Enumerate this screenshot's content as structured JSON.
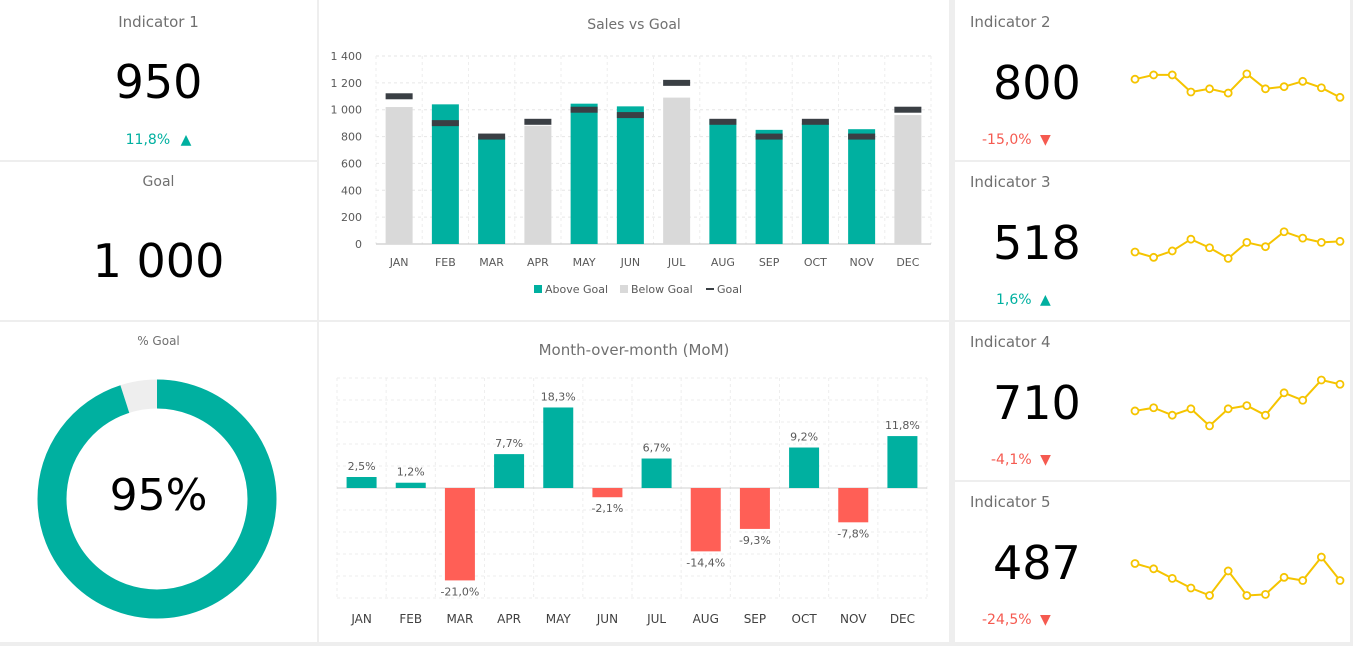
{
  "colors": {
    "teal": "#00b0a0",
    "gray": "#d9d9d9",
    "dark": "#3a3f44",
    "red": "#ff5f56",
    "yellow": "#f5c400"
  },
  "left": {
    "indicator1": {
      "title": "Indicator 1",
      "value": "950",
      "change": "11,8%",
      "direction": "up"
    },
    "goal": {
      "title": "Goal",
      "value": "1 000"
    },
    "pct_goal": {
      "title": "% Goal",
      "value": "95%",
      "fraction": 0.95
    }
  },
  "right": [
    {
      "title": "Indicator 2",
      "value": "800",
      "change": "-15,0%",
      "direction": "down",
      "trend": [
        42,
        46,
        46,
        30,
        33,
        29,
        47,
        33,
        35,
        40,
        34,
        25
      ]
    },
    {
      "title": "Indicator 3",
      "value": "518",
      "change": "1,6%",
      "direction": "up",
      "trend": [
        30,
        25,
        31,
        42,
        34,
        24,
        39,
        35,
        49,
        43,
        39,
        40
      ]
    },
    {
      "title": "Indicator 4",
      "value": "710",
      "change": "-4,1%",
      "direction": "down",
      "trend": [
        31,
        34,
        27,
        33,
        17,
        33,
        36,
        27,
        48,
        41,
        60,
        56
      ]
    },
    {
      "title": "Indicator 5",
      "value": "487",
      "change": "-24,5%",
      "direction": "down",
      "trend": [
        38,
        33,
        24,
        15,
        8,
        31,
        8,
        9,
        25,
        22,
        44,
        22
      ]
    }
  ],
  "chart_data": [
    {
      "type": "bar",
      "title": "Sales vs Goal",
      "categories": [
        "JAN",
        "FEB",
        "MAR",
        "APR",
        "MAY",
        "JUN",
        "JUL",
        "AUG",
        "SEP",
        "OCT",
        "NOV",
        "DEC"
      ],
      "series": [
        {
          "name": "Above Goal",
          "values": [
            null,
            1040,
            800,
            null,
            1045,
            1025,
            null,
            930,
            850,
            900,
            855,
            null
          ]
        },
        {
          "name": "Below Goal",
          "values": [
            1020,
            null,
            null,
            880,
            null,
            null,
            1090,
            null,
            null,
            null,
            null,
            960
          ]
        },
        {
          "name": "Goal",
          "values": [
            1100,
            900,
            800,
            910,
            1000,
            960,
            1200,
            910,
            800,
            910,
            800,
            1000
          ]
        }
      ],
      "ylim": [
        0,
        1400
      ],
      "yticks": [
        "0",
        "200",
        "400",
        "600",
        "800",
        "1 000",
        "1 200",
        "1 400"
      ],
      "grid": true,
      "legend": "bottom"
    },
    {
      "type": "bar",
      "title": "Month-over-month (MoM)",
      "categories": [
        "JAN",
        "FEB",
        "MAR",
        "APR",
        "MAY",
        "JUN",
        "JUL",
        "AUG",
        "SEP",
        "OCT",
        "NOV",
        "DEC"
      ],
      "values": [
        2.5,
        1.2,
        -21.0,
        7.7,
        18.3,
        -2.1,
        6.7,
        -14.4,
        -9.3,
        9.2,
        -7.8,
        11.8
      ],
      "labels": [
        "2,5%",
        "1,2%",
        "-21,0%",
        "7,7%",
        "18,3%",
        "-2,1%",
        "6,7%",
        "-14,4%",
        "-9,3%",
        "9,2%",
        "-7,8%",
        "11,8%"
      ],
      "ylim": [
        -25,
        25
      ],
      "grid": true
    }
  ]
}
